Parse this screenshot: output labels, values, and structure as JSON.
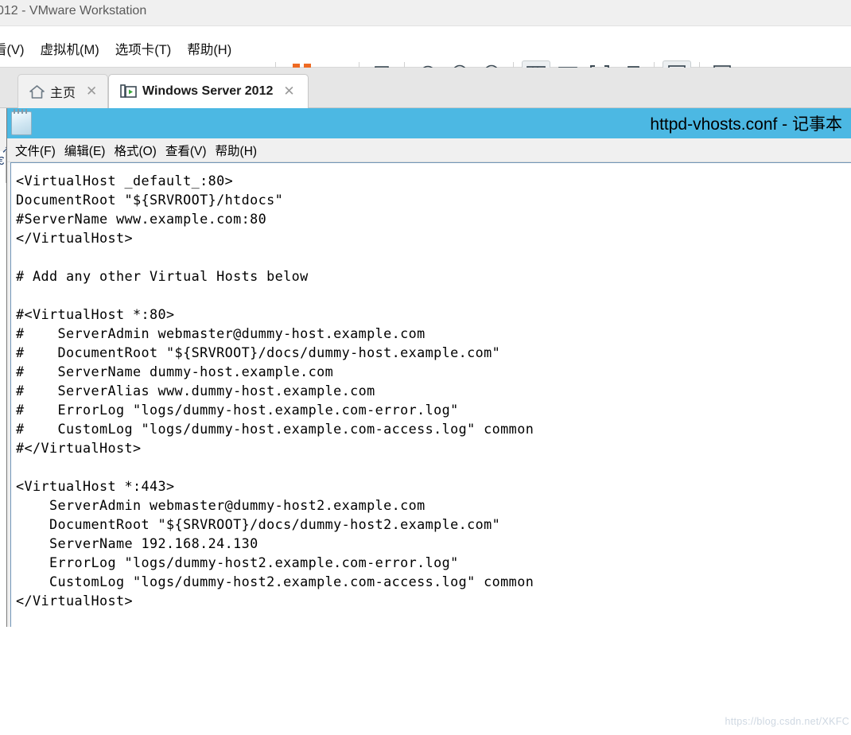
{
  "vmware": {
    "title": "012 - VMware Workstation",
    "menu": [
      {
        "label": "看(V)",
        "name": "menu-view"
      },
      {
        "label": "虚拟机(M)",
        "name": "menu-vm"
      },
      {
        "label": "选项卡(T)",
        "name": "menu-tabs"
      },
      {
        "label": "帮助(H)",
        "name": "menu-help"
      }
    ],
    "toolbar": [
      {
        "name": "suspend-button",
        "icon": "pause-icon"
      },
      {
        "name": "power-dropdown-button",
        "icon": "caret-down-icon"
      },
      {
        "name": "send-ctrl-alt-del-button",
        "icon": "send-keys-icon"
      },
      {
        "name": "take-snapshot-button",
        "icon": "snapshot-add-icon"
      },
      {
        "name": "revert-snapshot-button",
        "icon": "snapshot-revert-icon"
      },
      {
        "name": "manage-snapshots-button",
        "icon": "snapshot-manage-icon"
      },
      {
        "name": "show-library-button",
        "icon": "library-pane-icon"
      },
      {
        "name": "show-thumbnails-button",
        "icon": "thumbnail-bar-icon"
      },
      {
        "name": "fullscreen-button",
        "icon": "fullscreen-icon"
      },
      {
        "name": "unity-mode-button",
        "icon": "unity-icon"
      },
      {
        "name": "console-button",
        "icon": "console-icon"
      },
      {
        "name": "stretch-button",
        "icon": "stretch-icon"
      },
      {
        "name": "stretch-dropdown-button",
        "icon": "caret-down-icon"
      }
    ],
    "tabs": [
      {
        "label": "主页",
        "icon": "home-icon",
        "selected": false,
        "close": "✕"
      },
      {
        "label": "Windows Server 2012",
        "icon": "vm-running-icon",
        "selected": true,
        "close": "✕"
      }
    ]
  },
  "notepad": {
    "title": "httpd-vhosts.conf - 记事本",
    "icon": "notepad-icon",
    "menu": [
      {
        "label": "文件(F)",
        "name": "np-menu-file"
      },
      {
        "label": "编辑(E)",
        "name": "np-menu-edit"
      },
      {
        "label": "格式(O)",
        "name": "np-menu-format"
      },
      {
        "label": "查看(V)",
        "name": "np-menu-view"
      },
      {
        "label": "帮助(H)",
        "name": "np-menu-help"
      }
    ],
    "content": "<VirtualHost _default_:80>\nDocumentRoot \"${SRVROOT}/htdocs\"\n#ServerName www.example.com:80\n</VirtualHost>\n\n# Add any other Virtual Hosts below\n\n#<VirtualHost *:80>\n#    ServerAdmin webmaster@dummy-host.example.com\n#    DocumentRoot \"${SRVROOT}/docs/dummy-host.example.com\"\n#    ServerName dummy-host.example.com\n#    ServerAlias www.dummy-host.example.com\n#    ErrorLog \"logs/dummy-host.example.com-error.log\"\n#    CustomLog \"logs/dummy-host.example.com-access.log\" common\n#</VirtualHost>\n\n<VirtualHost *:443>\n    ServerAdmin webmaster@dummy-host2.example.com\n    DocumentRoot \"${SRVROOT}/docs/dummy-host2.example.com\"\n    ServerName 192.168.24.130\n    ErrorLog \"logs/dummy-host2.example.com-error.log\"\n    CustomLog \"logs/dummy-host2.example.com-access.log\" common\n</VirtualHost>",
    "scrollbar": {
      "left_arrow": "❮"
    }
  },
  "watermark": {
    "text": "https://blog.csdn.net/XKFC"
  },
  "colors": {
    "notepad_title_bg": "#4cb8e3",
    "accent_orange": "#ee6a23",
    "toolbar_icon": "#3c4a54",
    "window_border": "#7296b8"
  }
}
